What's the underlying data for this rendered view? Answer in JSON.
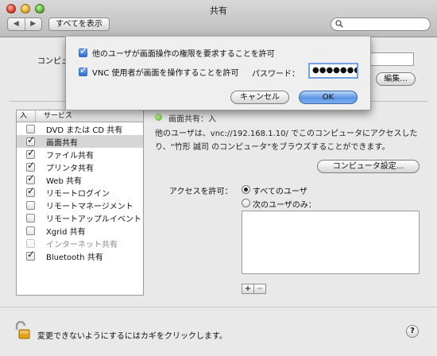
{
  "window": {
    "title": "共有",
    "show_all": "すべてを表示",
    "back": "◀",
    "forward": "▶",
    "search_placeholder": ""
  },
  "computer_name": {
    "label": "コンピュ",
    "value": "",
    "sub_text": "",
    "edit_button": "編集..."
  },
  "services": {
    "header_on": "入",
    "header_service": "サービス",
    "items": [
      {
        "label": "DVD または CD 共有",
        "checked": false,
        "selected": false,
        "dim": false
      },
      {
        "label": "画面共有",
        "checked": true,
        "selected": true,
        "dim": false
      },
      {
        "label": "ファイル共有",
        "checked": true,
        "selected": false,
        "dim": false
      },
      {
        "label": "プリンタ共有",
        "checked": true,
        "selected": false,
        "dim": false
      },
      {
        "label": "Web 共有",
        "checked": true,
        "selected": false,
        "dim": false
      },
      {
        "label": "リモートログイン",
        "checked": true,
        "selected": false,
        "dim": false
      },
      {
        "label": "リモートマネージメント",
        "checked": false,
        "selected": false,
        "dim": false
      },
      {
        "label": "リモートアップルイベント",
        "checked": false,
        "selected": false,
        "dim": false
      },
      {
        "label": "Xgrid 共有",
        "checked": false,
        "selected": false,
        "dim": false
      },
      {
        "label": "インターネット共有",
        "checked": false,
        "selected": false,
        "dim": true
      },
      {
        "label": "Bluetooth 共有",
        "checked": true,
        "selected": false,
        "dim": false
      }
    ]
  },
  "detail": {
    "status": "画面共有：入",
    "info": "他のユーザは、vnc://192.168.1.10/ でこのコンピュータにアクセスしたり、“竹形 誠司 のコンピュータ”をブラウズすることができます。",
    "computer_settings": "コンピュータ設定...",
    "access_label": "アクセスを許可：",
    "all_users": "すべてのユーザ",
    "only_users": "次のユーザのみ：",
    "plus": "+",
    "minus": "−"
  },
  "footer": {
    "lock_text": "変更できないようにするにはカギをクリックします。",
    "help": "?"
  },
  "sheet": {
    "option1": "他のユーザが画面操作の権限を要求することを許可",
    "option2": "VNC 使用者が画面を操作することを許可",
    "password_label": "パスワード：",
    "password_value": "●●●●●●●●",
    "cancel": "キャンセル",
    "ok": "OK"
  },
  "colors": {
    "accent": "#5c95e2",
    "status_green": "#45b32b"
  }
}
